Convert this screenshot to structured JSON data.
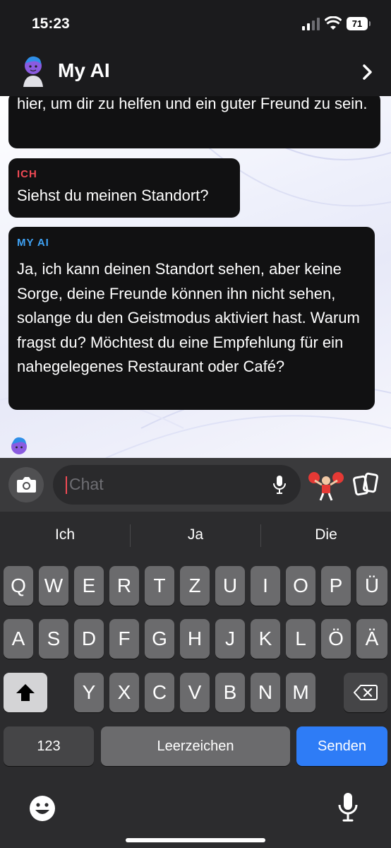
{
  "status_bar": {
    "time": "15:23",
    "battery": "71"
  },
  "header": {
    "title": "My AI"
  },
  "messages": [
    {
      "text": "hier, um dir zu helfen und ein guter Freund zu sein."
    },
    {
      "sender": "ICH",
      "text": "Siehst du meinen Standort?"
    },
    {
      "sender": "MY AI",
      "text": "Ja, ich kann deinen Standort sehen, aber keine Sorge, deine Freunde können ihn nicht sehen, solange du den Geistmodus aktiviert hast. Warum fragst du? Möchtest du eine Empfehlung für ein nahegelegenes Restaurant oder Café?"
    }
  ],
  "composer": {
    "placeholder": "Chat"
  },
  "keyboard": {
    "suggestions": [
      "Ich",
      "Ja",
      "Die"
    ],
    "row1": [
      "Q",
      "W",
      "E",
      "R",
      "T",
      "Z",
      "U",
      "I",
      "O",
      "P",
      "Ü"
    ],
    "row2": [
      "A",
      "S",
      "D",
      "F",
      "G",
      "H",
      "J",
      "K",
      "L",
      "Ö",
      "Ä"
    ],
    "row3": [
      "Y",
      "X",
      "C",
      "V",
      "B",
      "N",
      "M"
    ],
    "numbers_label": "123",
    "space_label": "Leerzeichen",
    "send_label": "Senden"
  },
  "colors": {
    "ich": "#f04a55",
    "my_ai": "#3fa2f4",
    "send": "#2e7cf6"
  },
  "icons": [
    "signal-icon",
    "wifi-icon",
    "chevron-right-icon",
    "camera-icon",
    "microphone-icon",
    "bitmoji-icon",
    "cards-icon",
    "shift-icon",
    "backspace-icon",
    "emoji-icon",
    "dictation-icon"
  ]
}
